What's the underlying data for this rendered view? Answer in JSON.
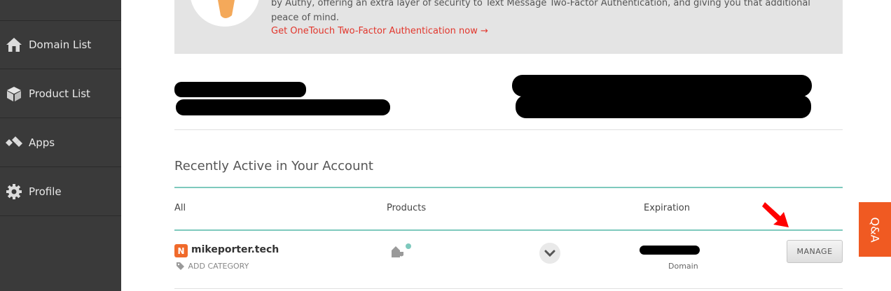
{
  "sidebar": {
    "items": [
      {
        "label": "Domain List",
        "icon": "home-icon"
      },
      {
        "label": "Product List",
        "icon": "box-icon"
      },
      {
        "label": "Apps",
        "icon": "apps-icon"
      },
      {
        "label": "Profile",
        "icon": "gear-icon"
      }
    ]
  },
  "promo": {
    "text": "by Authy, offering an extra layer of security to Text Message Two-Factor Authentication, and giving you that additional peace of mind.",
    "link": "Get OneTouch Two-Factor Authentication now →"
  },
  "recent": {
    "title": "Recently Active in Your Account",
    "columns": {
      "all": "All",
      "products": "Products",
      "expiration": "Expiration"
    },
    "row": {
      "name": "mikeporter.tech",
      "add_category": "ADD CATEGORY",
      "type": "Domain",
      "manage": "MANAGE"
    }
  },
  "qa": {
    "label": "Q&A"
  },
  "colors": {
    "sidebar": "#3a3a3a",
    "accent": "#e2362c",
    "teal": "#7ec9bd",
    "qa": "#f05a22"
  }
}
